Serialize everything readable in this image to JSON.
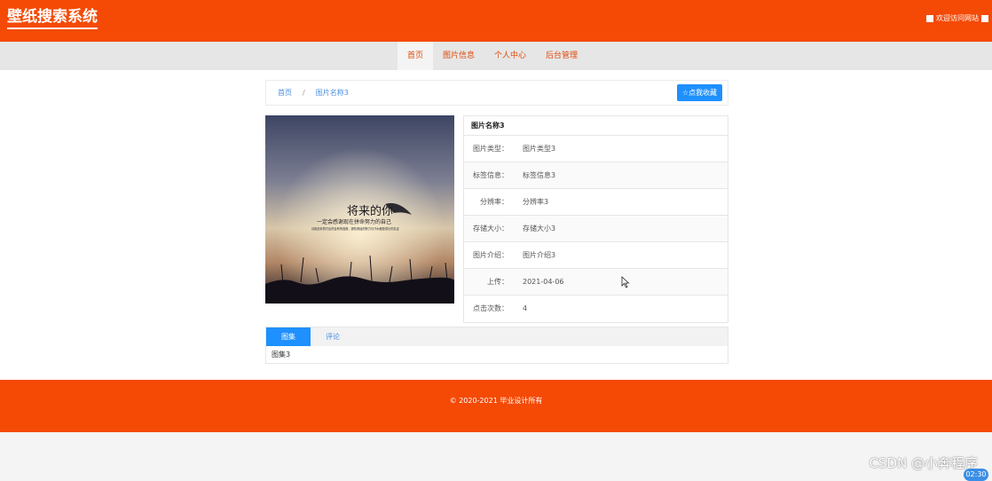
{
  "header": {
    "brand": "壁纸搜索系统",
    "welcome": "欢迎访问网站"
  },
  "nav": {
    "items": [
      "首页",
      "图片信息",
      "个人中心",
      "后台管理"
    ],
    "active": 0
  },
  "breadcrumb": {
    "home": "首页",
    "sep": "/",
    "current": "图片名称3"
  },
  "favorite_button": "☆点我收藏",
  "image": {
    "caption_title": "将来的你",
    "caption_sub": "一定会感谢现在拼命努力的自己",
    "caption_small": "请相信你的付出终会有所回报，那些曾经的努力与汗水都是成长的见证"
  },
  "detail": {
    "title": "图片名称3",
    "rows": [
      {
        "key": "图片类型：",
        "value": "图片类型3"
      },
      {
        "key": "标签信息：",
        "value": "标签信息3"
      },
      {
        "key": "分辨率：",
        "value": "分辨率3"
      },
      {
        "key": "存储大小：",
        "value": "存储大小3"
      },
      {
        "key": "图片介绍：",
        "value": "图片介绍3"
      },
      {
        "key": "上传：",
        "value": "2021-04-06"
      },
      {
        "key": "点击次数：",
        "value": "4"
      }
    ]
  },
  "tabs": {
    "items": [
      "图集",
      "评论"
    ],
    "active": 0,
    "content": "图集3"
  },
  "footer": {
    "copyright": "© 2020-2021 毕业设计所有"
  },
  "watermark": "CSDN @小奔程序",
  "timer": "02:30",
  "colors": {
    "primary": "#f44a06",
    "accent_blue": "#1e90ff"
  }
}
